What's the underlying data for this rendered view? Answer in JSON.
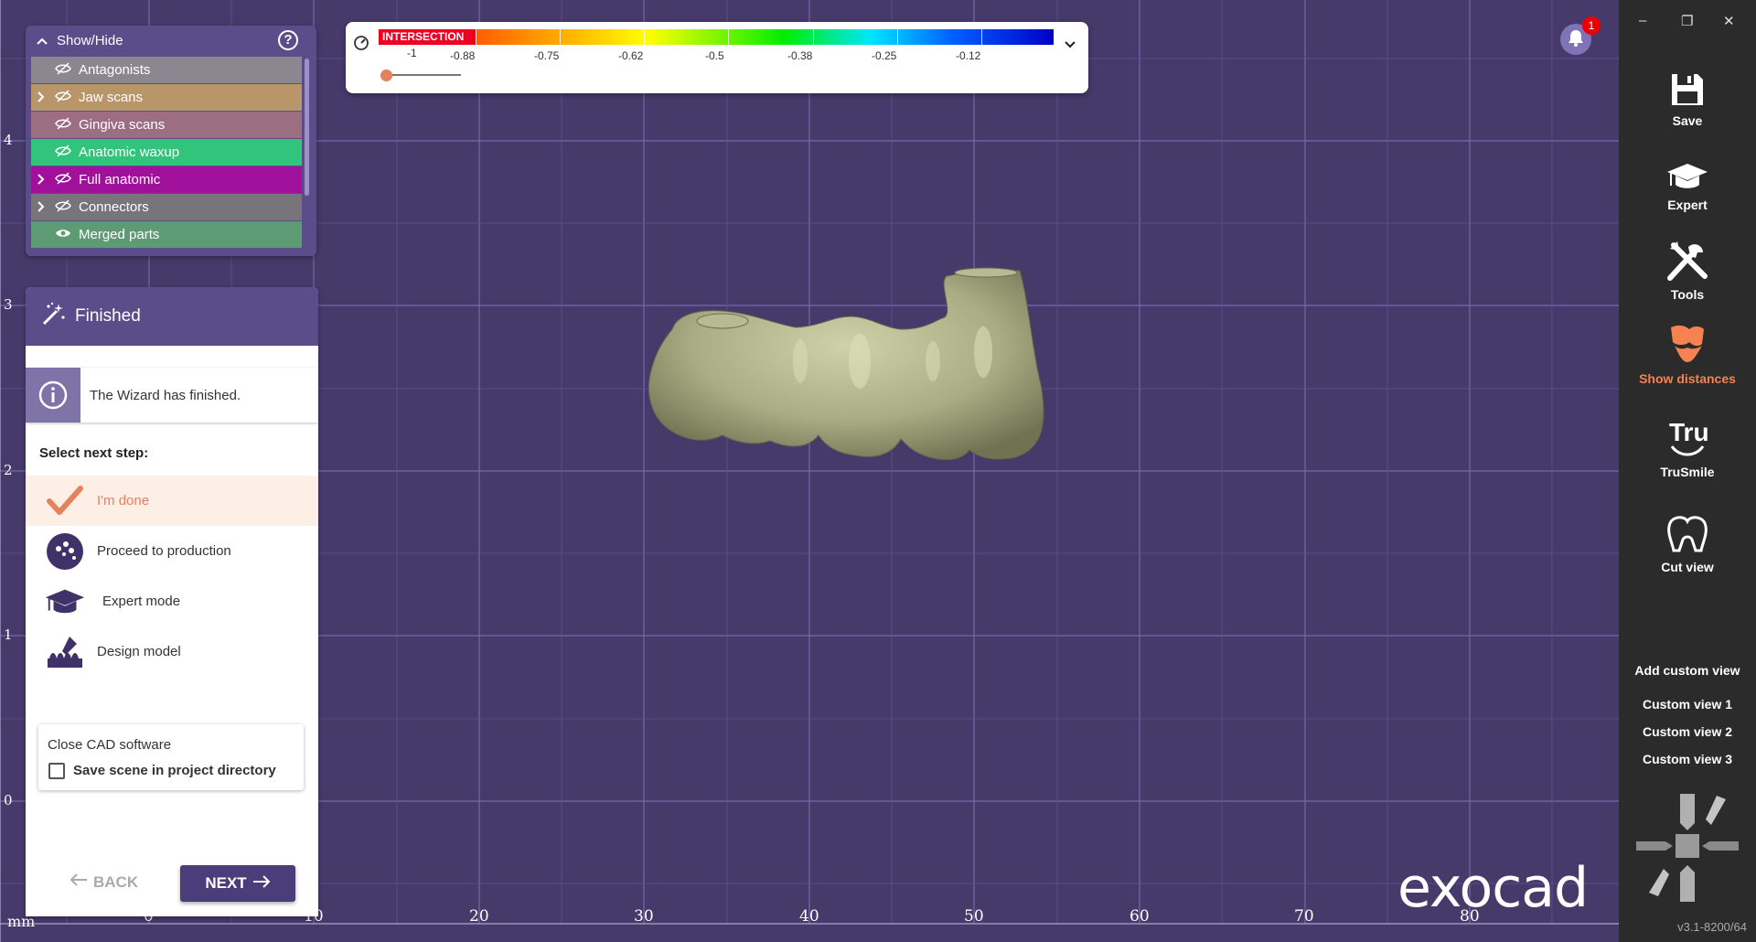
{
  "show_hide": {
    "title": "Show/Hide",
    "layers": [
      {
        "label": "Antagonists",
        "color": "#8b8790",
        "expandable": false,
        "visible": false
      },
      {
        "label": "Jaw scans",
        "color": "#b9966a",
        "expandable": true,
        "visible": false
      },
      {
        "label": "Gingiva scans",
        "color": "#9b6e82",
        "expandable": false,
        "visible": false
      },
      {
        "label": "Anatomic waxup",
        "color": "#33c47c",
        "expandable": false,
        "visible": false
      },
      {
        "label": "Full anatomic",
        "color": "#a0109a",
        "expandable": true,
        "visible": false
      },
      {
        "label": "Connectors",
        "color": "#777579",
        "expandable": true,
        "visible": false
      },
      {
        "label": "Merged parts",
        "color": "#5e9a74",
        "expandable": false,
        "visible": true
      }
    ]
  },
  "wizard": {
    "title": "Finished",
    "info": "The Wizard has finished.",
    "select_label": "Select next step:",
    "steps": [
      {
        "label": "I'm done",
        "icon": "checkmark-icon",
        "active": true
      },
      {
        "label": "Proceed to production",
        "icon": "production-icon",
        "active": false
      },
      {
        "label": "Expert mode",
        "icon": "graduation-cap-icon",
        "active": false
      },
      {
        "label": "Design model",
        "icon": "design-model-icon",
        "active": false
      }
    ],
    "close_title": "Close CAD software",
    "save_scene_label": "Save scene in project directory",
    "save_scene_checked": false,
    "back_label": "BACK",
    "next_label": "NEXT"
  },
  "color_scale": {
    "intersection_label": "INTERSECTION",
    "tick_labels": [
      "-1",
      "-0.88",
      "-0.75",
      "-0.62",
      "-0.5",
      "-0.38",
      "-0.25",
      "-0.12"
    ]
  },
  "notifications": {
    "count": "1"
  },
  "ruler": {
    "unit": "mm",
    "x_labels": [
      "0",
      "10",
      "20",
      "30",
      "40",
      "50",
      "60",
      "70",
      "80"
    ],
    "y_labels": [
      "4",
      "3",
      "2",
      "1",
      "0"
    ]
  },
  "logo": "exocad",
  "toolbar": {
    "items": [
      {
        "label": "Save",
        "icon": "save-icon"
      },
      {
        "label": "Expert",
        "icon": "graduation-cap-icon"
      },
      {
        "label": "Tools",
        "icon": "tools-icon"
      },
      {
        "label": "Show distances",
        "icon": "show-distances-icon",
        "highlight": true
      },
      {
        "label": "TruSmile",
        "icon": "trusmile-icon"
      },
      {
        "label": "Cut view",
        "icon": "cut-view-icon"
      }
    ],
    "add_custom_view": "Add custom view",
    "custom_views": [
      "Custom view 1",
      "Custom view 2",
      "Custom view 3"
    ],
    "version": "v3.1-8200/64"
  },
  "colors": {
    "background": "#463a6b",
    "panel_header": "#5a4d8a",
    "accent": "#e5825e",
    "toolbar": "#2b2b2b"
  }
}
